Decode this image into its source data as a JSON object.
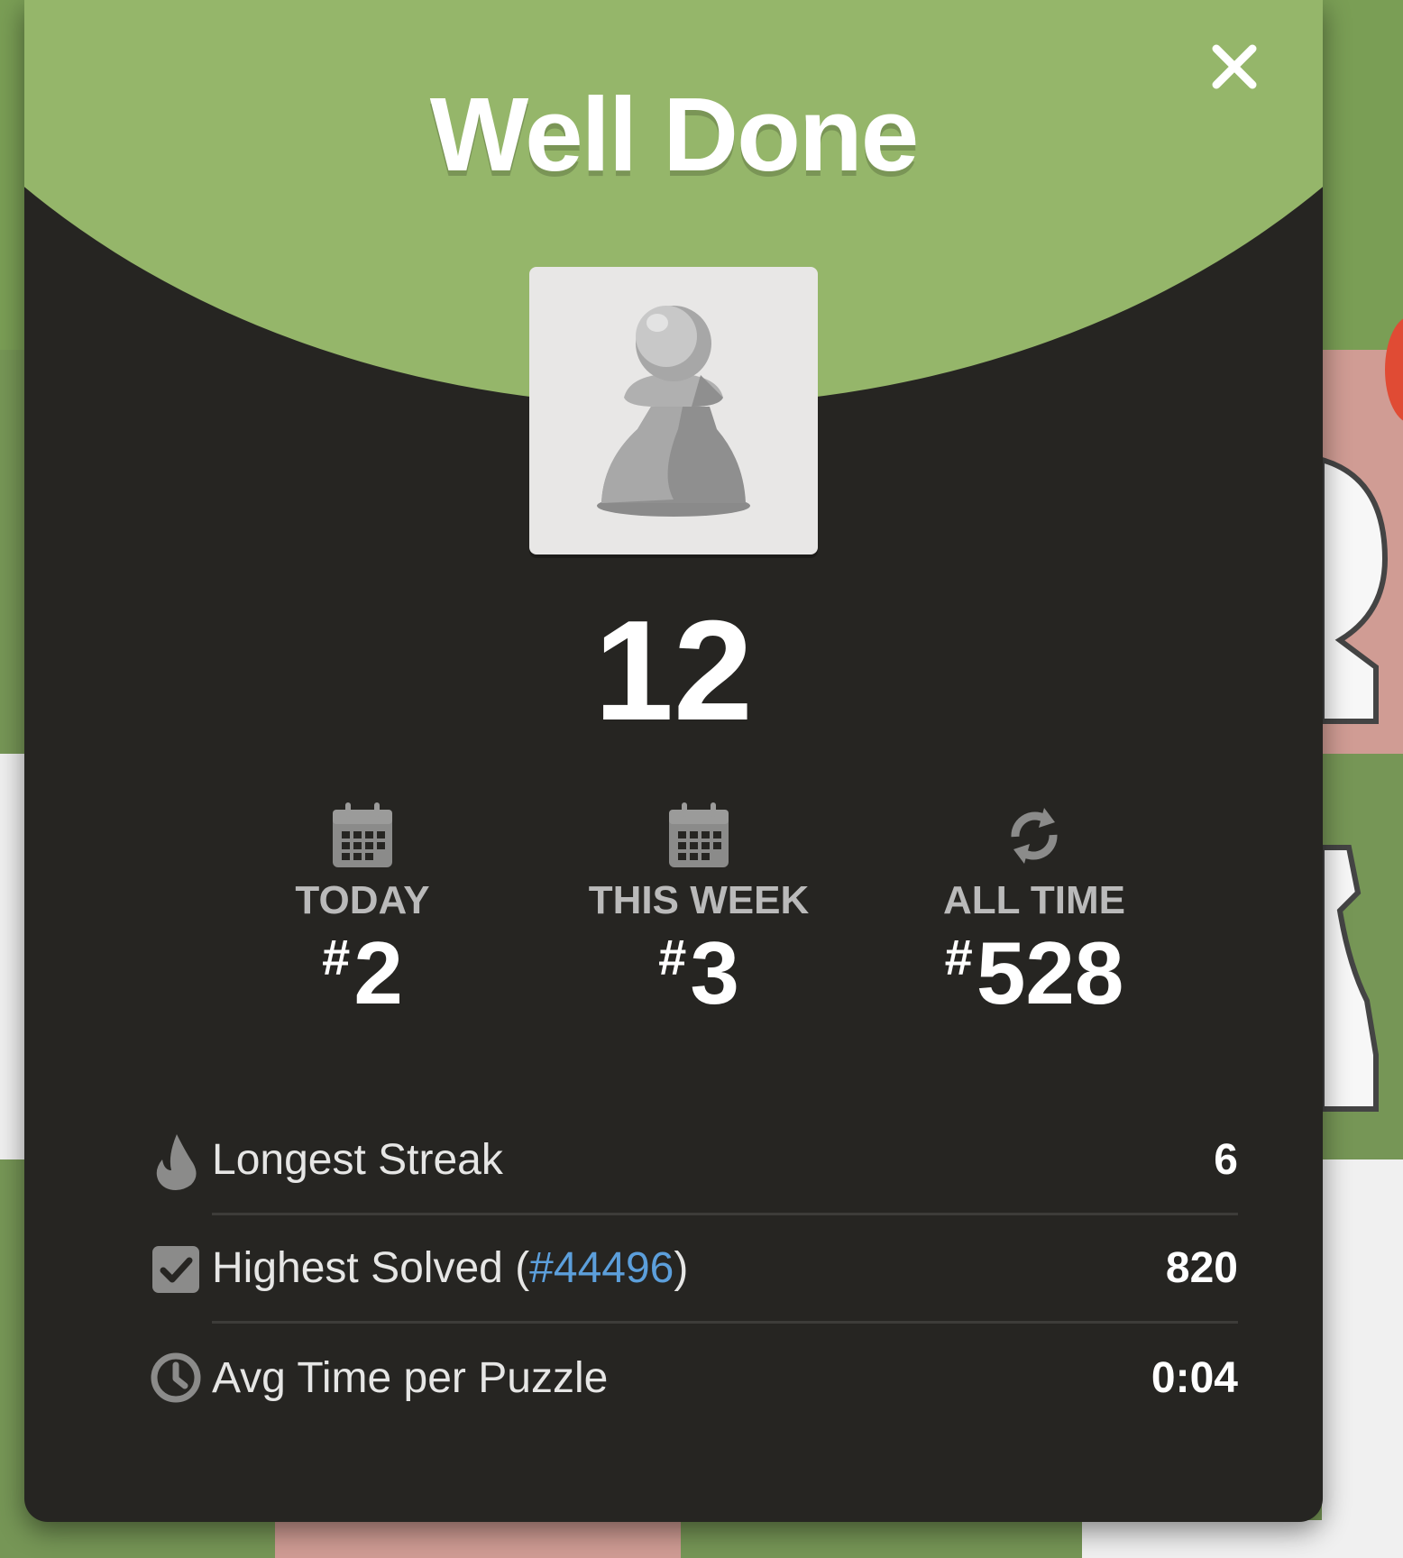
{
  "modal": {
    "title": "Well Done",
    "score": "12",
    "close_icon": "close-icon",
    "piece_icon": "pawn-icon"
  },
  "rankings": [
    {
      "icon": "calendar-icon",
      "label": "TODAY",
      "hash": "#",
      "value": "2"
    },
    {
      "icon": "calendar-icon",
      "label": "THIS WEEK",
      "hash": "#",
      "value": "3"
    },
    {
      "icon": "refresh-icon",
      "label": "ALL TIME",
      "hash": "#",
      "value": "528"
    }
  ],
  "stats": [
    {
      "icon": "flame-icon",
      "label": "Longest Streak",
      "value": "6"
    },
    {
      "icon": "checkbox-icon",
      "label_prefix": "Highest Solved (",
      "link": "#44496",
      "label_suffix": ")",
      "value": "820"
    },
    {
      "icon": "clock-icon",
      "label": "Avg Time per Puzzle",
      "value": "0:04"
    }
  ],
  "colors": {
    "header_green": "#95b66a",
    "modal_bg": "#262522",
    "link_blue": "#5c9fdb"
  }
}
